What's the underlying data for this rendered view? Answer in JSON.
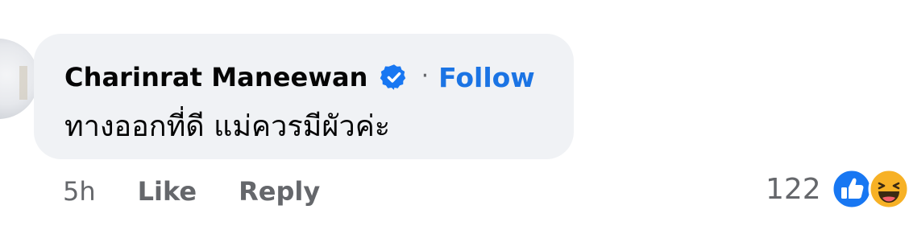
{
  "comment": {
    "author_name": "Charinrat Maneewan",
    "verified": true,
    "separator": "·",
    "follow_label": "Follow",
    "text": "ทางออกที่ดี แม่ควรมีผัวค่ะ"
  },
  "actions": {
    "time": "5h",
    "like_label": "Like",
    "reply_label": "Reply"
  },
  "reactions": {
    "count": "122",
    "types": [
      "like-icon",
      "haha-icon"
    ]
  },
  "colors": {
    "bubble": "#f0f2f5",
    "link": "#1b74e4",
    "muted": "#65676b",
    "text": "#050505",
    "verified": "#1877f2",
    "like": "#1877f2",
    "haha": "#f7b125"
  }
}
